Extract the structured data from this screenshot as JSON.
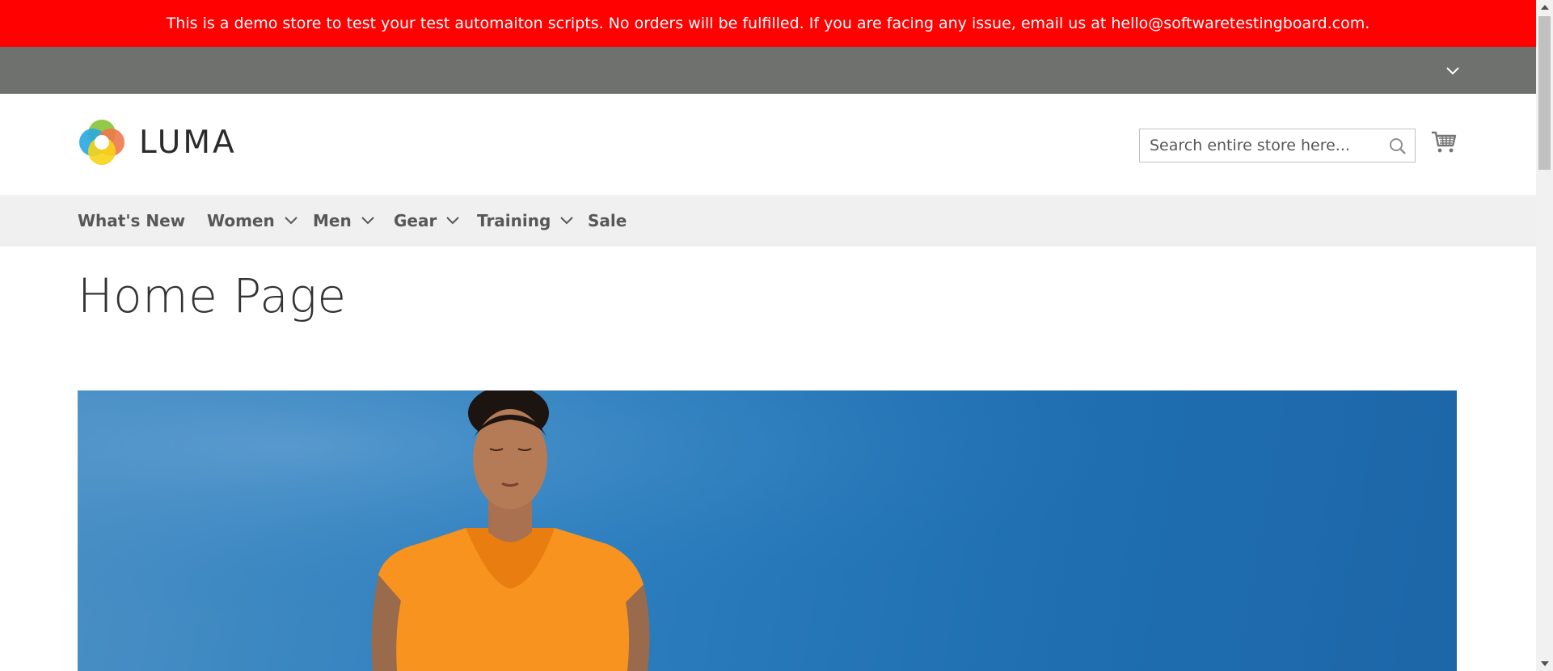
{
  "banner": {
    "text": "This is a demo store to test your test automaiton scripts. No orders will be fulfilled. If you are facing any issue, email us at hello@softwaretestingboard.com."
  },
  "header": {
    "logo_text": "LUMA",
    "search": {
      "placeholder": "Search entire store here...",
      "value": ""
    },
    "icons": [
      "chevron-down-icon",
      "search-icon",
      "cart-icon",
      "luma-logo-icon"
    ]
  },
  "nav": {
    "items": [
      {
        "label": "What's New",
        "has_submenu": false
      },
      {
        "label": "Women",
        "has_submenu": true
      },
      {
        "label": "Men",
        "has_submenu": true
      },
      {
        "label": "Gear",
        "has_submenu": true
      },
      {
        "label": "Training",
        "has_submenu": true
      },
      {
        "label": "Sale",
        "has_submenu": false
      }
    ]
  },
  "main": {
    "page_title": "Home Page"
  },
  "colors": {
    "banner_bg": "#ff0101",
    "top_panel_bg": "#6e716e",
    "nav_bg": "#f0f0f0",
    "hero_sky": "#2d7fbf",
    "shirt": "#f7931e"
  }
}
